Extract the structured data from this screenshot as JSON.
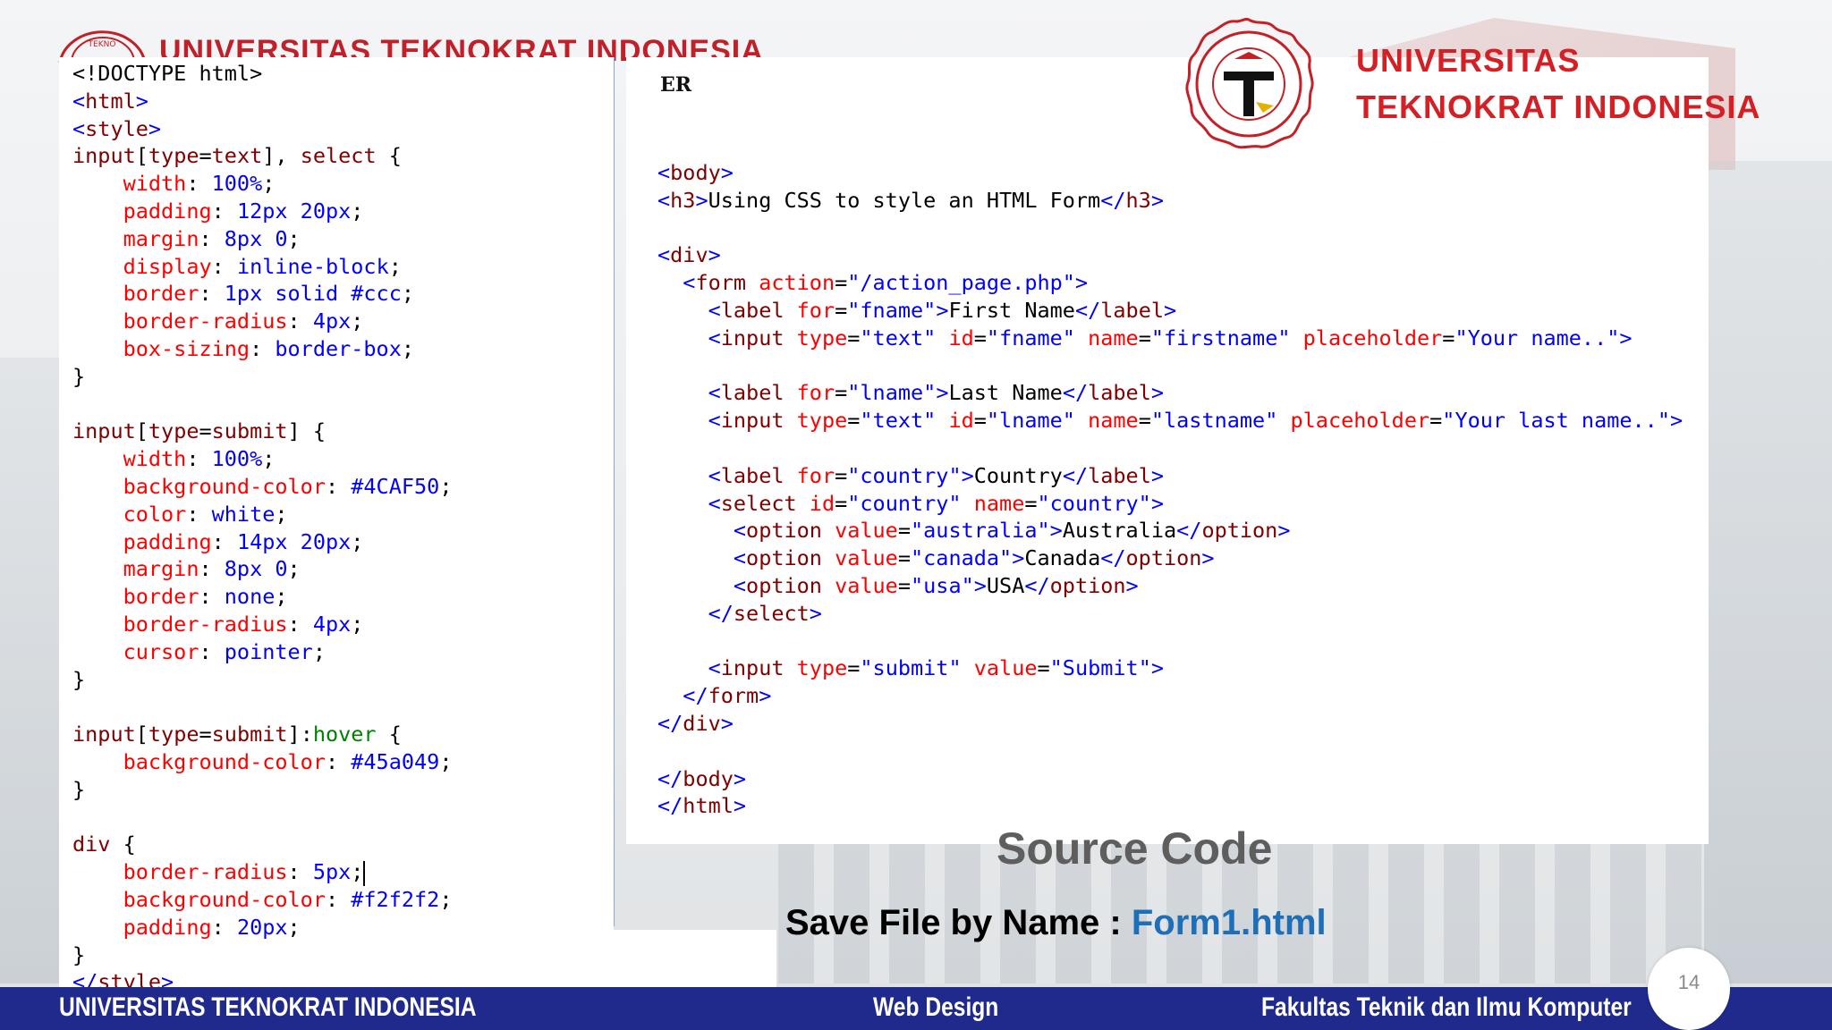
{
  "header": {
    "faint_title": "UNIVERSITAS TEKNOKRAT INDONESIA",
    "brand_line1": "UNIVERSITAS",
    "brand_line2": "TEKNOKRAT INDONESIA",
    "fragment": "ER"
  },
  "colors": {
    "brand_red": "#d42025",
    "footer_blue": "#1f2a8c",
    "filename_blue": "#1f6fb8"
  },
  "code_left": [
    [
      [
        "t-plain",
        "<!DOCTYPE html>"
      ]
    ],
    [
      [
        "t-br",
        "<"
      ],
      [
        "t-tag",
        "html"
      ],
      [
        "t-br",
        ">"
      ]
    ],
    [
      [
        "t-br",
        "<"
      ],
      [
        "t-tag",
        "style"
      ],
      [
        "t-br",
        ">"
      ]
    ],
    [
      [
        "t-sel",
        "input"
      ],
      [
        "t-plain",
        "["
      ],
      [
        "t-sel",
        "type"
      ],
      [
        "t-plain",
        "="
      ],
      [
        "t-sel",
        "text"
      ],
      [
        "t-plain",
        "], "
      ],
      [
        "t-sel",
        "select"
      ],
      [
        "t-plain",
        " {"
      ]
    ],
    [
      [
        "t-plain",
        "    "
      ],
      [
        "t-prop",
        "width"
      ],
      [
        "t-plain",
        ": "
      ],
      [
        "t-val",
        "100%"
      ],
      [
        "t-plain",
        ";"
      ]
    ],
    [
      [
        "t-plain",
        "    "
      ],
      [
        "t-prop",
        "padding"
      ],
      [
        "t-plain",
        ": "
      ],
      [
        "t-val",
        "12px 20px"
      ],
      [
        "t-plain",
        ";"
      ]
    ],
    [
      [
        "t-plain",
        "    "
      ],
      [
        "t-prop",
        "margin"
      ],
      [
        "t-plain",
        ": "
      ],
      [
        "t-val",
        "8px 0"
      ],
      [
        "t-plain",
        ";"
      ]
    ],
    [
      [
        "t-plain",
        "    "
      ],
      [
        "t-prop",
        "display"
      ],
      [
        "t-plain",
        ": "
      ],
      [
        "t-val",
        "inline-block"
      ],
      [
        "t-plain",
        ";"
      ]
    ],
    [
      [
        "t-plain",
        "    "
      ],
      [
        "t-prop",
        "border"
      ],
      [
        "t-plain",
        ": "
      ],
      [
        "t-val",
        "1px solid #ccc"
      ],
      [
        "t-plain",
        ";"
      ]
    ],
    [
      [
        "t-plain",
        "    "
      ],
      [
        "t-prop",
        "border-radius"
      ],
      [
        "t-plain",
        ": "
      ],
      [
        "t-val",
        "4px"
      ],
      [
        "t-plain",
        ";"
      ]
    ],
    [
      [
        "t-plain",
        "    "
      ],
      [
        "t-prop",
        "box-sizing"
      ],
      [
        "t-plain",
        ": "
      ],
      [
        "t-val",
        "border-box"
      ],
      [
        "t-plain",
        ";"
      ]
    ],
    [
      [
        "t-plain",
        "}"
      ]
    ],
    [
      [
        "t-plain",
        ""
      ]
    ],
    [
      [
        "t-sel",
        "input"
      ],
      [
        "t-plain",
        "["
      ],
      [
        "t-sel",
        "type"
      ],
      [
        "t-plain",
        "="
      ],
      [
        "t-sel",
        "submit"
      ],
      [
        "t-plain",
        "] {"
      ]
    ],
    [
      [
        "t-plain",
        "    "
      ],
      [
        "t-prop",
        "width"
      ],
      [
        "t-plain",
        ": "
      ],
      [
        "t-val",
        "100%"
      ],
      [
        "t-plain",
        ";"
      ]
    ],
    [
      [
        "t-plain",
        "    "
      ],
      [
        "t-prop",
        "background-color"
      ],
      [
        "t-plain",
        ": "
      ],
      [
        "t-val",
        "#4CAF50"
      ],
      [
        "t-plain",
        ";"
      ]
    ],
    [
      [
        "t-plain",
        "    "
      ],
      [
        "t-prop",
        "color"
      ],
      [
        "t-plain",
        ": "
      ],
      [
        "t-val",
        "white"
      ],
      [
        "t-plain",
        ";"
      ]
    ],
    [
      [
        "t-plain",
        "    "
      ],
      [
        "t-prop",
        "padding"
      ],
      [
        "t-plain",
        ": "
      ],
      [
        "t-val",
        "14px 20px"
      ],
      [
        "t-plain",
        ";"
      ]
    ],
    [
      [
        "t-plain",
        "    "
      ],
      [
        "t-prop",
        "margin"
      ],
      [
        "t-plain",
        ": "
      ],
      [
        "t-val",
        "8px 0"
      ],
      [
        "t-plain",
        ";"
      ]
    ],
    [
      [
        "t-plain",
        "    "
      ],
      [
        "t-prop",
        "border"
      ],
      [
        "t-plain",
        ": "
      ],
      [
        "t-val",
        "none"
      ],
      [
        "t-plain",
        ";"
      ]
    ],
    [
      [
        "t-plain",
        "    "
      ],
      [
        "t-prop",
        "border-radius"
      ],
      [
        "t-plain",
        ": "
      ],
      [
        "t-val",
        "4px"
      ],
      [
        "t-plain",
        ";"
      ]
    ],
    [
      [
        "t-plain",
        "    "
      ],
      [
        "t-prop",
        "cursor"
      ],
      [
        "t-plain",
        ": "
      ],
      [
        "t-val",
        "pointer"
      ],
      [
        "t-plain",
        ";"
      ]
    ],
    [
      [
        "t-plain",
        "}"
      ]
    ],
    [
      [
        "t-plain",
        ""
      ]
    ],
    [
      [
        "t-sel",
        "input"
      ],
      [
        "t-plain",
        "["
      ],
      [
        "t-sel",
        "type"
      ],
      [
        "t-plain",
        "="
      ],
      [
        "t-sel",
        "submit"
      ],
      [
        "t-plain",
        "]:"
      ],
      [
        "t-pseudo",
        "hover"
      ],
      [
        "t-plain",
        " {"
      ]
    ],
    [
      [
        "t-plain",
        "    "
      ],
      [
        "t-prop",
        "background-color"
      ],
      [
        "t-plain",
        ": "
      ],
      [
        "t-val",
        "#45a049"
      ],
      [
        "t-plain",
        ";"
      ]
    ],
    [
      [
        "t-plain",
        "}"
      ]
    ],
    [
      [
        "t-plain",
        ""
      ]
    ],
    [
      [
        "t-sel",
        "div"
      ],
      [
        "t-plain",
        " {"
      ]
    ],
    [
      [
        "t-plain",
        "    "
      ],
      [
        "t-prop",
        "border-radius"
      ],
      [
        "t-plain",
        ": "
      ],
      [
        "t-val",
        "5px"
      ],
      [
        "t-plain",
        ";"
      ],
      [
        "cursor",
        ""
      ]
    ],
    [
      [
        "t-plain",
        "    "
      ],
      [
        "t-prop",
        "background-color"
      ],
      [
        "t-plain",
        ": "
      ],
      [
        "t-val",
        "#f2f2f2"
      ],
      [
        "t-plain",
        ";"
      ]
    ],
    [
      [
        "t-plain",
        "    "
      ],
      [
        "t-prop",
        "padding"
      ],
      [
        "t-plain",
        ": "
      ],
      [
        "t-val",
        "20px"
      ],
      [
        "t-plain",
        ";"
      ]
    ],
    [
      [
        "t-plain",
        "}"
      ]
    ],
    [
      [
        "t-br",
        "</"
      ],
      [
        "t-tag",
        "style"
      ],
      [
        "t-br",
        ">"
      ]
    ]
  ],
  "code_right": [
    [
      [
        "t-br",
        "<"
      ],
      [
        "t-tag",
        "body"
      ],
      [
        "t-br",
        ">"
      ]
    ],
    [
      [
        "t-br",
        "<"
      ],
      [
        "t-tag",
        "h3"
      ],
      [
        "t-br",
        ">"
      ],
      [
        "t-plain",
        "Using CSS to style an HTML Form"
      ],
      [
        "t-br",
        "</"
      ],
      [
        "t-tag",
        "h3"
      ],
      [
        "t-br",
        ">"
      ]
    ],
    [
      [
        "t-plain",
        ""
      ]
    ],
    [
      [
        "t-br",
        "<"
      ],
      [
        "t-tag",
        "div"
      ],
      [
        "t-br",
        ">"
      ]
    ],
    [
      [
        "t-plain",
        "  "
      ],
      [
        "t-br",
        "<"
      ],
      [
        "t-tag",
        "form"
      ],
      [
        "t-plain",
        " "
      ],
      [
        "t-attr",
        "action"
      ],
      [
        "t-plain",
        "="
      ],
      [
        "t-str",
        "\"/action_page.php\""
      ],
      [
        "t-br",
        ">"
      ]
    ],
    [
      [
        "t-plain",
        "    "
      ],
      [
        "t-br",
        "<"
      ],
      [
        "t-tag",
        "label"
      ],
      [
        "t-plain",
        " "
      ],
      [
        "t-attr",
        "for"
      ],
      [
        "t-plain",
        "="
      ],
      [
        "t-str",
        "\"fname\""
      ],
      [
        "t-br",
        ">"
      ],
      [
        "t-plain",
        "First Name"
      ],
      [
        "t-br",
        "</"
      ],
      [
        "t-tag",
        "label"
      ],
      [
        "t-br",
        ">"
      ]
    ],
    [
      [
        "t-plain",
        "    "
      ],
      [
        "t-br",
        "<"
      ],
      [
        "t-tag",
        "input"
      ],
      [
        "t-plain",
        " "
      ],
      [
        "t-attr",
        "type"
      ],
      [
        "t-plain",
        "="
      ],
      [
        "t-str",
        "\"text\""
      ],
      [
        "t-plain",
        " "
      ],
      [
        "t-attr",
        "id"
      ],
      [
        "t-plain",
        "="
      ],
      [
        "t-str",
        "\"fname\""
      ],
      [
        "t-plain",
        " "
      ],
      [
        "t-attr",
        "name"
      ],
      [
        "t-plain",
        "="
      ],
      [
        "t-str",
        "\"firstname\""
      ],
      [
        "t-plain",
        " "
      ],
      [
        "t-attr",
        "placeholder"
      ],
      [
        "t-plain",
        "="
      ],
      [
        "t-str",
        "\"Your name..\""
      ],
      [
        "t-br",
        ">"
      ]
    ],
    [
      [
        "t-plain",
        ""
      ]
    ],
    [
      [
        "t-plain",
        "    "
      ],
      [
        "t-br",
        "<"
      ],
      [
        "t-tag",
        "label"
      ],
      [
        "t-plain",
        " "
      ],
      [
        "t-attr",
        "for"
      ],
      [
        "t-plain",
        "="
      ],
      [
        "t-str",
        "\"lname\""
      ],
      [
        "t-br",
        ">"
      ],
      [
        "t-plain",
        "Last Name"
      ],
      [
        "t-br",
        "</"
      ],
      [
        "t-tag",
        "label"
      ],
      [
        "t-br",
        ">"
      ]
    ],
    [
      [
        "t-plain",
        "    "
      ],
      [
        "t-br",
        "<"
      ],
      [
        "t-tag",
        "input"
      ],
      [
        "t-plain",
        " "
      ],
      [
        "t-attr",
        "type"
      ],
      [
        "t-plain",
        "="
      ],
      [
        "t-str",
        "\"text\""
      ],
      [
        "t-plain",
        " "
      ],
      [
        "t-attr",
        "id"
      ],
      [
        "t-plain",
        "="
      ],
      [
        "t-str",
        "\"lname\""
      ],
      [
        "t-plain",
        " "
      ],
      [
        "t-attr",
        "name"
      ],
      [
        "t-plain",
        "="
      ],
      [
        "t-str",
        "\"lastname\""
      ],
      [
        "t-plain",
        " "
      ],
      [
        "t-attr",
        "placeholder"
      ],
      [
        "t-plain",
        "="
      ],
      [
        "t-str",
        "\"Your last name..\""
      ],
      [
        "t-br",
        ">"
      ]
    ],
    [
      [
        "t-plain",
        ""
      ]
    ],
    [
      [
        "t-plain",
        "    "
      ],
      [
        "t-br",
        "<"
      ],
      [
        "t-tag",
        "label"
      ],
      [
        "t-plain",
        " "
      ],
      [
        "t-attr",
        "for"
      ],
      [
        "t-plain",
        "="
      ],
      [
        "t-str",
        "\"country\""
      ],
      [
        "t-br",
        ">"
      ],
      [
        "t-plain",
        "Country"
      ],
      [
        "t-br",
        "</"
      ],
      [
        "t-tag",
        "label"
      ],
      [
        "t-br",
        ">"
      ]
    ],
    [
      [
        "t-plain",
        "    "
      ],
      [
        "t-br",
        "<"
      ],
      [
        "t-tag",
        "select"
      ],
      [
        "t-plain",
        " "
      ],
      [
        "t-attr",
        "id"
      ],
      [
        "t-plain",
        "="
      ],
      [
        "t-str",
        "\"country\""
      ],
      [
        "t-plain",
        " "
      ],
      [
        "t-attr",
        "name"
      ],
      [
        "t-plain",
        "="
      ],
      [
        "t-str",
        "\"country\""
      ],
      [
        "t-br",
        ">"
      ]
    ],
    [
      [
        "t-plain",
        "      "
      ],
      [
        "t-br",
        "<"
      ],
      [
        "t-tag",
        "option"
      ],
      [
        "t-plain",
        " "
      ],
      [
        "t-attr",
        "value"
      ],
      [
        "t-plain",
        "="
      ],
      [
        "t-str",
        "\"australia\""
      ],
      [
        "t-br",
        ">"
      ],
      [
        "t-plain",
        "Australia"
      ],
      [
        "t-br",
        "</"
      ],
      [
        "t-tag",
        "option"
      ],
      [
        "t-br",
        ">"
      ]
    ],
    [
      [
        "t-plain",
        "      "
      ],
      [
        "t-br",
        "<"
      ],
      [
        "t-tag",
        "option"
      ],
      [
        "t-plain",
        " "
      ],
      [
        "t-attr",
        "value"
      ],
      [
        "t-plain",
        "="
      ],
      [
        "t-str",
        "\"canada\""
      ],
      [
        "t-br",
        ">"
      ],
      [
        "t-plain",
        "Canada"
      ],
      [
        "t-br",
        "</"
      ],
      [
        "t-tag",
        "option"
      ],
      [
        "t-br",
        ">"
      ]
    ],
    [
      [
        "t-plain",
        "      "
      ],
      [
        "t-br",
        "<"
      ],
      [
        "t-tag",
        "option"
      ],
      [
        "t-plain",
        " "
      ],
      [
        "t-attr",
        "value"
      ],
      [
        "t-plain",
        "="
      ],
      [
        "t-str",
        "\"usa\""
      ],
      [
        "t-br",
        ">"
      ],
      [
        "t-plain",
        "USA"
      ],
      [
        "t-br",
        "</"
      ],
      [
        "t-tag",
        "option"
      ],
      [
        "t-br",
        ">"
      ]
    ],
    [
      [
        "t-plain",
        "    "
      ],
      [
        "t-br",
        "</"
      ],
      [
        "t-tag",
        "select"
      ],
      [
        "t-br",
        ">"
      ]
    ],
    [
      [
        "t-plain",
        ""
      ]
    ],
    [
      [
        "t-plain",
        "    "
      ],
      [
        "t-br",
        "<"
      ],
      [
        "t-tag",
        "input"
      ],
      [
        "t-plain",
        " "
      ],
      [
        "t-attr",
        "type"
      ],
      [
        "t-plain",
        "="
      ],
      [
        "t-str",
        "\"submit\""
      ],
      [
        "t-plain",
        " "
      ],
      [
        "t-attr",
        "value"
      ],
      [
        "t-plain",
        "="
      ],
      [
        "t-str",
        "\"Submit\""
      ],
      [
        "t-br",
        ">"
      ]
    ],
    [
      [
        "t-plain",
        "  "
      ],
      [
        "t-br",
        "</"
      ],
      [
        "t-tag",
        "form"
      ],
      [
        "t-br",
        ">"
      ]
    ],
    [
      [
        "t-br",
        "</"
      ],
      [
        "t-tag",
        "div"
      ],
      [
        "t-br",
        ">"
      ]
    ],
    [
      [
        "t-plain",
        ""
      ]
    ],
    [
      [
        "t-br",
        "</"
      ],
      [
        "t-tag",
        "body"
      ],
      [
        "t-br",
        ">"
      ]
    ],
    [
      [
        "t-br",
        "</"
      ],
      [
        "t-tag",
        "html"
      ],
      [
        "t-br",
        ">"
      ]
    ]
  ],
  "caption": {
    "source_code": "Source Code",
    "save_label": "Save File by Name :",
    "filename": "Form1.html"
  },
  "footer": {
    "left": "UNIVERSITAS TEKNOKRAT INDONESIA",
    "middle": "Web Design",
    "right": "Fakultas Teknik dan Ilmu Komputer",
    "page_number": "14"
  }
}
